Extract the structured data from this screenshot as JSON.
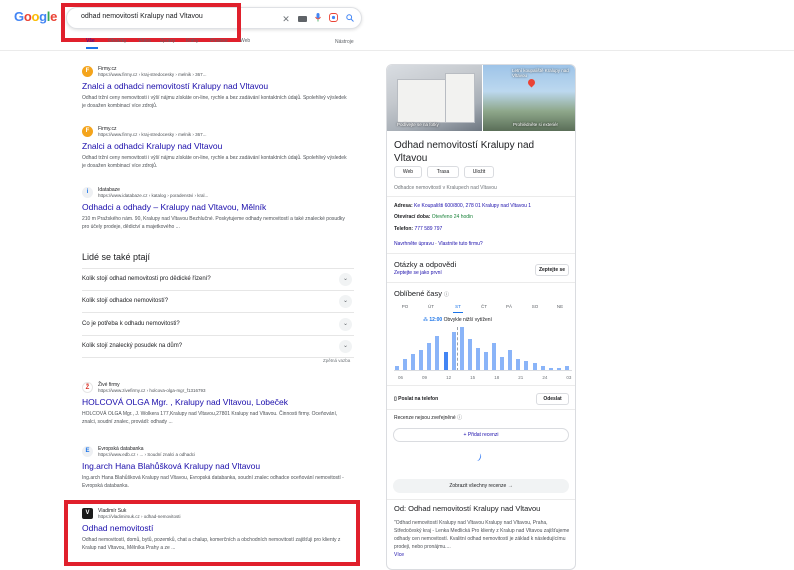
{
  "search": {
    "query": "odhad nemovitostí Kralupy nad Vltavou",
    "clear_icon": "close-icon",
    "keyboard_icon": "keyboard-icon",
    "mic_icon": "mic-icon",
    "lens_icon": "lens-icon",
    "search_icon": "search-icon"
  },
  "logo": [
    "G",
    "o",
    "o",
    "g",
    "l",
    "e"
  ],
  "logo_colors": [
    "#4285f4",
    "#ea4335",
    "#fbbc05",
    "#4285f4",
    "#34a853",
    "#ea4335"
  ],
  "tabs": [
    "Vše",
    "Obrázky",
    "Videa",
    "Zprávy",
    "Knihy",
    "Finance",
    "Web"
  ],
  "tools_label": "Nástroje",
  "results": [
    {
      "source": "Firmy.cz",
      "url": "https://www.firmy.cz › kraj-stredocesky › melnik › 367...",
      "title": "Znalci a odhadci nemovitostí Kralupy nad Vltavou",
      "snippet": "Odhad tržní ceny nemovitosti i výší nájmu získáte on-line, rychle a bez zadávání kontaktních údajů. Spolehlivý výsledek je dosažen kombinací více zdrojů."
    },
    {
      "source": "Firmy.cz",
      "url": "https://www.firmy.cz › kraj-stredocesky › melnik › 367...",
      "title": "Znalci a odhadci Kralupy nad Vltavou",
      "snippet": "Odhad tržní ceny nemovitosti i výší nájmu získáte on-line, rychle a bez zadávání kontaktních údajů. Spolehlivý výsledek je dosažen kombinací více zdrojů."
    },
    {
      "source": "Idatabaze",
      "url": "https://www.idatabaze.cz › katalog › poradenstvi › kral...",
      "title": "Odhadci a odhady – Kralupy nad Vltavou, Mělník",
      "snippet": "210 m Pražského nám. 90, Kralupy nad Vltavou Bezhlučné. Poskytujeme odhady nemovitostí a také znalecké posudky pro účely prodeje, dědictví a majetkového ..."
    }
  ],
  "paa": {
    "title": "Lidé se také ptají",
    "questions": [
      "Kolik stojí odhad nemovitosti pro dědické řízení?",
      "Kolik stojí odhadce nemovitostí?",
      "Co je potřeba k odhadu nemovitosti?",
      "Kolik stojí znalecký posudek na dům?"
    ],
    "feedback": "Zpětná vazba"
  },
  "results2": [
    {
      "source": "Živé firmy",
      "url": "https://www.zivefirmy.cz › holcova-olga-mgr_f1316793",
      "title": "HOLCOVÁ OLGA Mgr. , Kralupy nad Vltavou, Lobeček",
      "snippet": "HOLCOVÁ OLGA Mgr., J. Wolkera 177,Kralupy nad Vltavou,27801 Kralupy nad Vltavou. Činnosti firmy. Oceňování, znalci, soudní znalec, provádí: odhady ..."
    },
    {
      "source": "Evropská databanka",
      "url": "https://www.edb.cz › ... › Soudní znalci a odhadci",
      "title": "Ing.arch Hana Blahůšková Kralupy nad Vltavou",
      "snippet": "Ing.arch Hana Blahůšková Kralupy nad Vltavou, Evropská databanka, soudní znalec odhadce oceňování nemovitostí - Evropská databanka."
    },
    {
      "source": "Vladimír Suk",
      "url": "https://vladimirsuk.cz › odhad-nemovitosti",
      "title": "Odhad nemovitostí",
      "snippet": "Odhad nemovitostí, domů, bytů, pozemků, chat a chalup, komerčních a obchodních nemovitostí zajišťuji pro klienty z Kralup nad Vltavou, Mělníka Prahy a ze ..."
    }
  ],
  "kp": {
    "photo_label_1": "Podívejte se na fotky",
    "photo_label_2": "Prohlédněte si exteriér",
    "map_label": "Letní koupaliště Kralupy nad Vltavou",
    "title": "Odhad nemovitostí Kralupy nad Vltavou",
    "buttons": [
      "Web",
      "Trasa",
      "Uložit"
    ],
    "subtitle": "Odhadce nemovitostí v Kralupech nad Vltavou",
    "address_label": "Adresa:",
    "address": "Ke Koupališti 600/800, 278 01 Kralupy nad Vltavou 1",
    "hours_label": "Otevírací doba:",
    "hours": "Otevřeno 24 hodin",
    "phone_label": "Telefon:",
    "phone": "777 589 797",
    "suggest": "Navrhněte úpravu",
    "own": "Vlastníte tuto firmu?",
    "qa_title": "Otázky a odpovědi",
    "qa_first": "Zeptejte se jako první",
    "ask": "Zeptejte se",
    "popular": "Oblíbené časy",
    "days": [
      "PO",
      "ÚT",
      "ST",
      "ČT",
      "PÁ",
      "SO",
      "NE"
    ],
    "live_time": "12:00",
    "live_text": "Obvykle nižší vytížení",
    "ticks": [
      "06",
      "09",
      "12",
      "15",
      "18",
      "21",
      "24",
      "03"
    ],
    "send_phone": "Poslat na telefon",
    "send": "Odeslat",
    "reviews": "Recenze nejsou zveřejněné",
    "add_review": "Přidat recenzi",
    "all_reviews": "Zobrazit všechny recenze",
    "from_title": "Od: Odhad nemovitostí Kralupy nad Vltavou",
    "description": "\"Odhad nemovitostí Kralupy nad Vltavou Kralupy nad Vltavou, Praha, Středočeský kraj - Lenka Medlická Pro klienty z Kralup nad Vltavou zajišťujeme odhady cen nemovitostí. Kvalitní odhad nemovitostí je základ k následujícímu prodeji, nebo pronájmu....",
    "more": "Více"
  },
  "chart_data": {
    "type": "bar",
    "title": "Oblíbené časy",
    "categories": [
      "06",
      "07",
      "08",
      "09",
      "10",
      "11",
      "12",
      "13",
      "14",
      "15",
      "16",
      "17",
      "18",
      "19",
      "20",
      "21",
      "22",
      "23",
      "24",
      "01",
      "02",
      "03"
    ],
    "values": [
      10,
      25,
      35,
      45,
      60,
      75,
      40,
      85,
      95,
      70,
      50,
      40,
      60,
      30,
      45,
      25,
      20,
      15,
      10,
      5,
      5,
      8
    ],
    "highlight_index": 6,
    "xlabel": "",
    "ylabel": ""
  }
}
